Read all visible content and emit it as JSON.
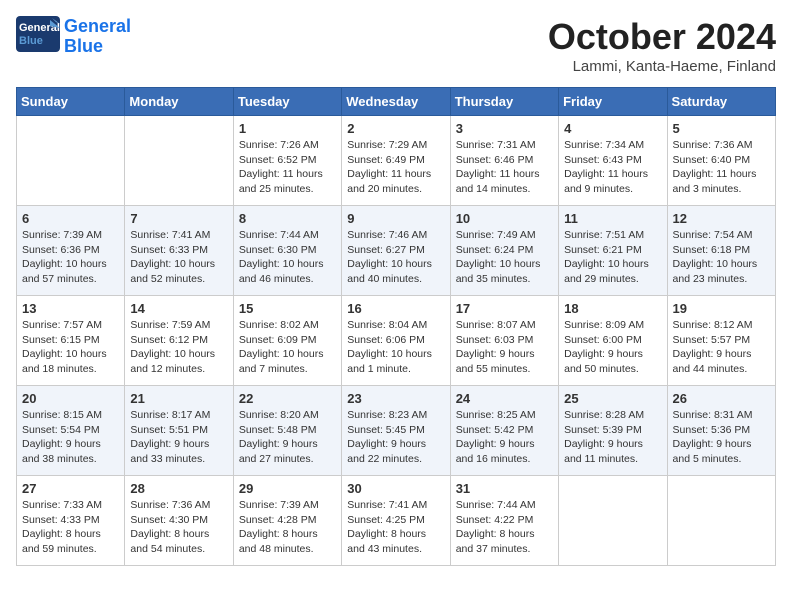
{
  "header": {
    "logo_general": "General",
    "logo_blue": "Blue",
    "month": "October 2024",
    "location": "Lammi, Kanta-Haeme, Finland"
  },
  "weekdays": [
    "Sunday",
    "Monday",
    "Tuesday",
    "Wednesday",
    "Thursday",
    "Friday",
    "Saturday"
  ],
  "weeks": [
    [
      {
        "day": "",
        "info": ""
      },
      {
        "day": "",
        "info": ""
      },
      {
        "day": "1",
        "info": "Sunrise: 7:26 AM\nSunset: 6:52 PM\nDaylight: 11 hours\nand 25 minutes."
      },
      {
        "day": "2",
        "info": "Sunrise: 7:29 AM\nSunset: 6:49 PM\nDaylight: 11 hours\nand 20 minutes."
      },
      {
        "day": "3",
        "info": "Sunrise: 7:31 AM\nSunset: 6:46 PM\nDaylight: 11 hours\nand 14 minutes."
      },
      {
        "day": "4",
        "info": "Sunrise: 7:34 AM\nSunset: 6:43 PM\nDaylight: 11 hours\nand 9 minutes."
      },
      {
        "day": "5",
        "info": "Sunrise: 7:36 AM\nSunset: 6:40 PM\nDaylight: 11 hours\nand 3 minutes."
      }
    ],
    [
      {
        "day": "6",
        "info": "Sunrise: 7:39 AM\nSunset: 6:36 PM\nDaylight: 10 hours\nand 57 minutes."
      },
      {
        "day": "7",
        "info": "Sunrise: 7:41 AM\nSunset: 6:33 PM\nDaylight: 10 hours\nand 52 minutes."
      },
      {
        "day": "8",
        "info": "Sunrise: 7:44 AM\nSunset: 6:30 PM\nDaylight: 10 hours\nand 46 minutes."
      },
      {
        "day": "9",
        "info": "Sunrise: 7:46 AM\nSunset: 6:27 PM\nDaylight: 10 hours\nand 40 minutes."
      },
      {
        "day": "10",
        "info": "Sunrise: 7:49 AM\nSunset: 6:24 PM\nDaylight: 10 hours\nand 35 minutes."
      },
      {
        "day": "11",
        "info": "Sunrise: 7:51 AM\nSunset: 6:21 PM\nDaylight: 10 hours\nand 29 minutes."
      },
      {
        "day": "12",
        "info": "Sunrise: 7:54 AM\nSunset: 6:18 PM\nDaylight: 10 hours\nand 23 minutes."
      }
    ],
    [
      {
        "day": "13",
        "info": "Sunrise: 7:57 AM\nSunset: 6:15 PM\nDaylight: 10 hours\nand 18 minutes."
      },
      {
        "day": "14",
        "info": "Sunrise: 7:59 AM\nSunset: 6:12 PM\nDaylight: 10 hours\nand 12 minutes."
      },
      {
        "day": "15",
        "info": "Sunrise: 8:02 AM\nSunset: 6:09 PM\nDaylight: 10 hours\nand 7 minutes."
      },
      {
        "day": "16",
        "info": "Sunrise: 8:04 AM\nSunset: 6:06 PM\nDaylight: 10 hours\nand 1 minute."
      },
      {
        "day": "17",
        "info": "Sunrise: 8:07 AM\nSunset: 6:03 PM\nDaylight: 9 hours\nand 55 minutes."
      },
      {
        "day": "18",
        "info": "Sunrise: 8:09 AM\nSunset: 6:00 PM\nDaylight: 9 hours\nand 50 minutes."
      },
      {
        "day": "19",
        "info": "Sunrise: 8:12 AM\nSunset: 5:57 PM\nDaylight: 9 hours\nand 44 minutes."
      }
    ],
    [
      {
        "day": "20",
        "info": "Sunrise: 8:15 AM\nSunset: 5:54 PM\nDaylight: 9 hours\nand 38 minutes."
      },
      {
        "day": "21",
        "info": "Sunrise: 8:17 AM\nSunset: 5:51 PM\nDaylight: 9 hours\nand 33 minutes."
      },
      {
        "day": "22",
        "info": "Sunrise: 8:20 AM\nSunset: 5:48 PM\nDaylight: 9 hours\nand 27 minutes."
      },
      {
        "day": "23",
        "info": "Sunrise: 8:23 AM\nSunset: 5:45 PM\nDaylight: 9 hours\nand 22 minutes."
      },
      {
        "day": "24",
        "info": "Sunrise: 8:25 AM\nSunset: 5:42 PM\nDaylight: 9 hours\nand 16 minutes."
      },
      {
        "day": "25",
        "info": "Sunrise: 8:28 AM\nSunset: 5:39 PM\nDaylight: 9 hours\nand 11 minutes."
      },
      {
        "day": "26",
        "info": "Sunrise: 8:31 AM\nSunset: 5:36 PM\nDaylight: 9 hours\nand 5 minutes."
      }
    ],
    [
      {
        "day": "27",
        "info": "Sunrise: 7:33 AM\nSunset: 4:33 PM\nDaylight: 8 hours\nand 59 minutes."
      },
      {
        "day": "28",
        "info": "Sunrise: 7:36 AM\nSunset: 4:30 PM\nDaylight: 8 hours\nand 54 minutes."
      },
      {
        "day": "29",
        "info": "Sunrise: 7:39 AM\nSunset: 4:28 PM\nDaylight: 8 hours\nand 48 minutes."
      },
      {
        "day": "30",
        "info": "Sunrise: 7:41 AM\nSunset: 4:25 PM\nDaylight: 8 hours\nand 43 minutes."
      },
      {
        "day": "31",
        "info": "Sunrise: 7:44 AM\nSunset: 4:22 PM\nDaylight: 8 hours\nand 37 minutes."
      },
      {
        "day": "",
        "info": ""
      },
      {
        "day": "",
        "info": ""
      }
    ]
  ]
}
